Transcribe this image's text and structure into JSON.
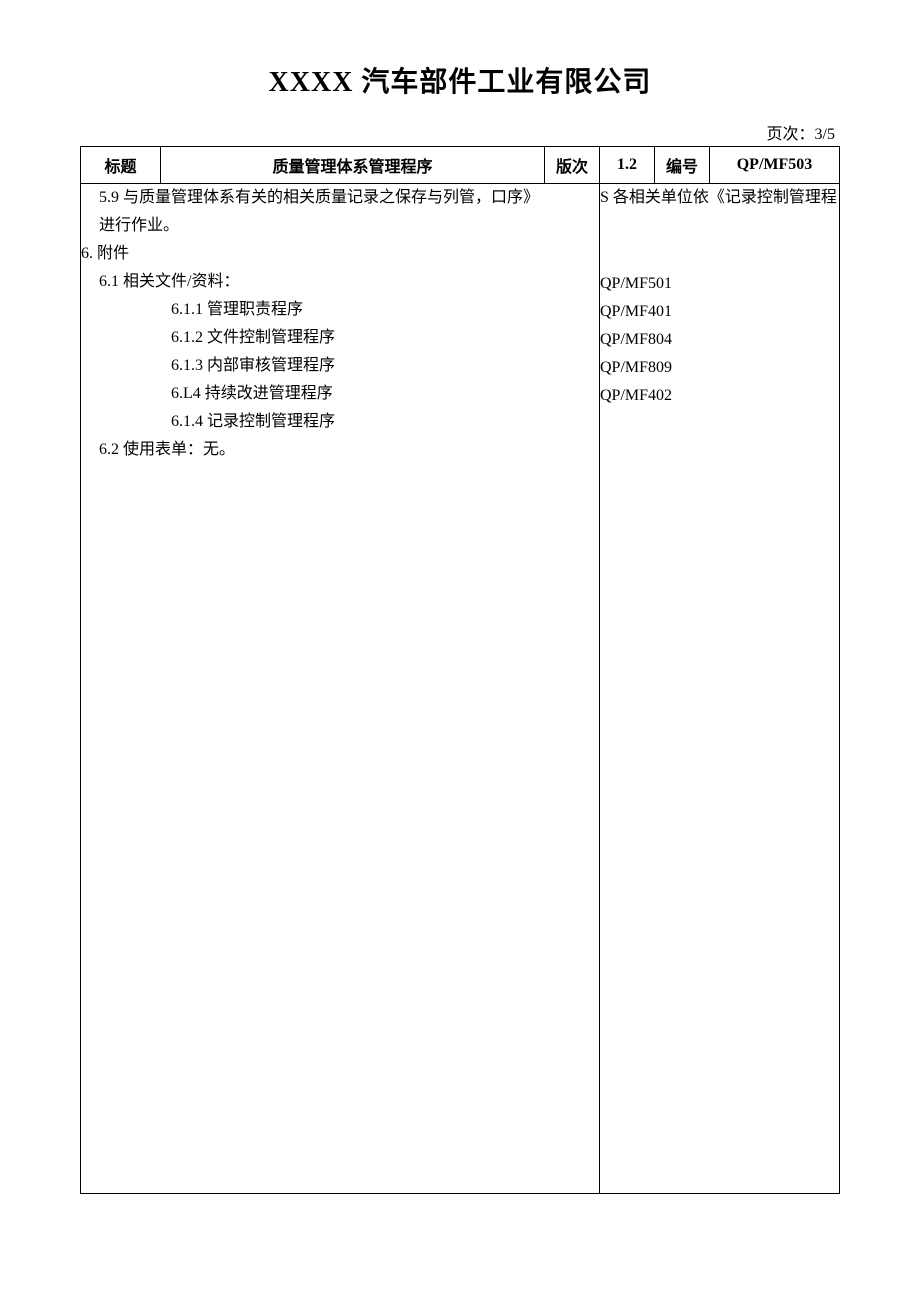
{
  "company_name": "XXXX 汽车部件工业有限公司",
  "page_indicator": "页次：3/5",
  "header": {
    "title_label": "标题",
    "title_value": "质量管理体系管理程序",
    "version_label": "版次",
    "version_value": "1.2",
    "number_label": "编号",
    "number_value": "QP/MF503"
  },
  "content": {
    "section_5_9_left": "5.9 与质量管理体系有关的相关质量记录之保存与列管，口序》",
    "section_5_9_cont": "进行作业。",
    "section_6": "6. 附件",
    "section_6_1": "6.1 相关文件/资料：",
    "items": [
      {
        "num": "6.1.1",
        "name": "管理职责程序",
        "code": "QP/MF501"
      },
      {
        "num": "6.1.2",
        "name": "文件控制管理程序",
        "code": "QP/MF401"
      },
      {
        "num": "6.1.3",
        "name": "内部审核管理程序",
        "code": "QP/MF804"
      },
      {
        "num": "6.L4",
        "name": "持续改进管理程序",
        "code": "QP/MF809"
      },
      {
        "num": "6.1.4",
        "name": "记录控制管理程序",
        "code": "QP/MF402"
      }
    ],
    "section_6_2": "6.2 使用表单：无。",
    "right_top": "S 各相关单位依《记录控制管理程"
  }
}
